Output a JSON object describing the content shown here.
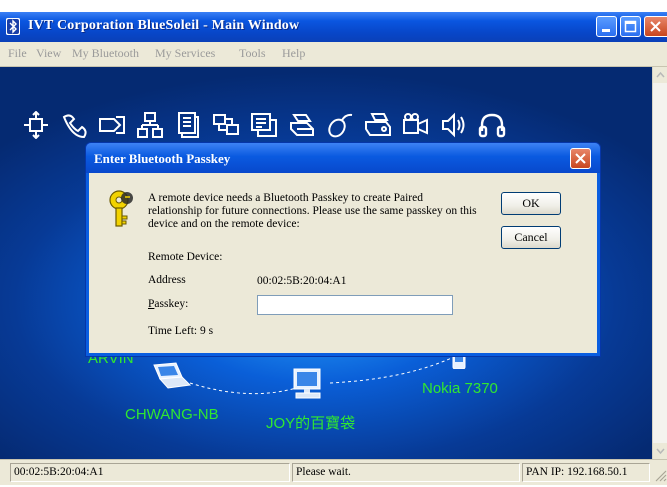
{
  "window": {
    "title": "IVT Corporation BlueSoleil - Main Window"
  },
  "menu": {
    "items": [
      "File",
      "View",
      "My Bluetooth",
      "My Services",
      "Tools",
      "Help"
    ]
  },
  "services": {
    "icons": [
      "network-access-icon",
      "dial-up-icon",
      "file-transfer-icon",
      "lan-access-icon",
      "object-push-icon",
      "pan-icon",
      "sync-icon",
      "printer-icon",
      "hid-mouse-icon",
      "fax-icon",
      "av-icon",
      "audio-gateway-icon",
      "headset-icon"
    ]
  },
  "devices": [
    {
      "name": "ARVIN"
    },
    {
      "name": "CHWANG-NB"
    },
    {
      "name": "JOY的百寶袋"
    },
    {
      "name": "Nokia 7370"
    }
  ],
  "dialog": {
    "title": "Enter Bluetooth Passkey",
    "message": "A remote device needs a Bluetooth Passkey to create Paired relationship for future connections. Please use the same passkey on this device and on the remote device:",
    "remote_device_label": "Remote Device:",
    "address_label": "Address",
    "address_value": "00:02:5B:20:04:A1",
    "passkey_label": "Passkey:",
    "passkey_value": "",
    "time_left": "Time Left: 9 s",
    "ok_label": "OK",
    "cancel_label": "Cancel"
  },
  "status": {
    "address": "00:02:5B:20:04:A1",
    "message": "Please wait.",
    "pan_ip": "PAN IP: 192.168.50.1"
  },
  "colors": {
    "title_bar": "#0a56e0",
    "device_label": "#30e830",
    "background_center": "#2aa6ff",
    "background_edge": "#052a72"
  }
}
